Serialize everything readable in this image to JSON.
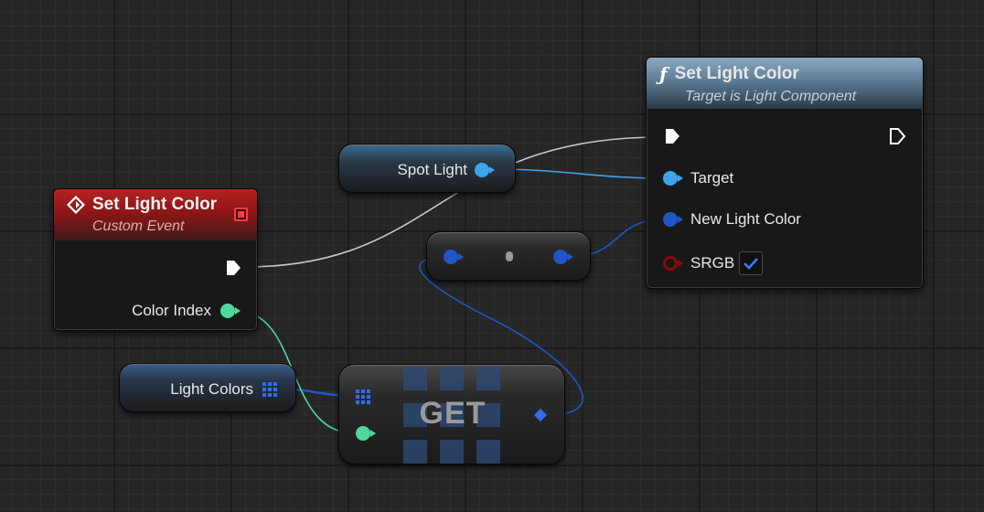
{
  "colors": {
    "exec_pin": "#ffffff",
    "object_pin": "#3fa4ee",
    "struct_pin": "#1f56c8",
    "integer_pin": "#4fd8a0",
    "bool_pin": "#8a0b0b",
    "event_header": "#9d1c1c",
    "function_header": "#6f8fa8"
  },
  "event_node": {
    "title": "Set Light Color",
    "subtitle": "Custom Event",
    "output_pin_label": "Color Index",
    "header_icon": "event-diamond-icon",
    "delegate_icon": "delegate-square-icon"
  },
  "spot_light_node": {
    "label": "Spot Light"
  },
  "light_colors_node": {
    "label": "Light Colors",
    "icon": "array-grid-icon"
  },
  "reroute_node": {
    "label": ""
  },
  "get_node": {
    "label": "GET"
  },
  "function_node": {
    "title": "Set Light Color",
    "subtitle": "Target is Light Component",
    "title_icon": "function-f-icon",
    "function_glyph": "ƒ",
    "pins": {
      "target": "Target",
      "new_light_color": "New Light Color",
      "srgb": "SRGB"
    },
    "srgb_checked": true
  }
}
